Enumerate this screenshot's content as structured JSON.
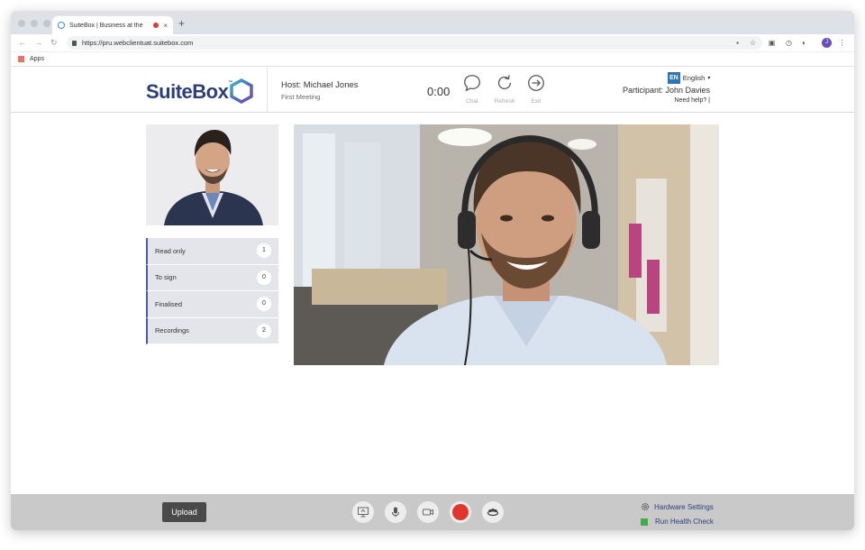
{
  "browser": {
    "tab_title": "SuiteBox | Business at the",
    "tab_close": "×",
    "new_tab": "+",
    "url": "https://pru.webclientuat.suitebox.com",
    "profile_initial": "J",
    "bookmarks_apps": "Apps"
  },
  "header": {
    "logo": "SuiteBox",
    "logo_tm": "™",
    "host": "Host: Michael Jones",
    "meeting": "First Meeting",
    "timer": "0:00",
    "chat_label": "Chat",
    "refresh_label": "Refresh",
    "exit_label": "Exit",
    "lang_code": "EN",
    "lang_name": "English",
    "participant": "Participant: John Davies",
    "help": "Need help? |"
  },
  "documents": [
    {
      "label": "Read only",
      "count": "1"
    },
    {
      "label": "To sign",
      "count": "0"
    },
    {
      "label": "Finalised",
      "count": "0"
    },
    {
      "label": "Recordings",
      "count": "2"
    }
  ],
  "bottom": {
    "upload": "Upload",
    "hardware_settings": "Hardware Settings",
    "health_check": "Run Health Check"
  },
  "colors": {
    "brand": "#2c3f7a",
    "record": "#e2352e",
    "health": "#3fae49",
    "lang_badge": "#2f74b8"
  }
}
